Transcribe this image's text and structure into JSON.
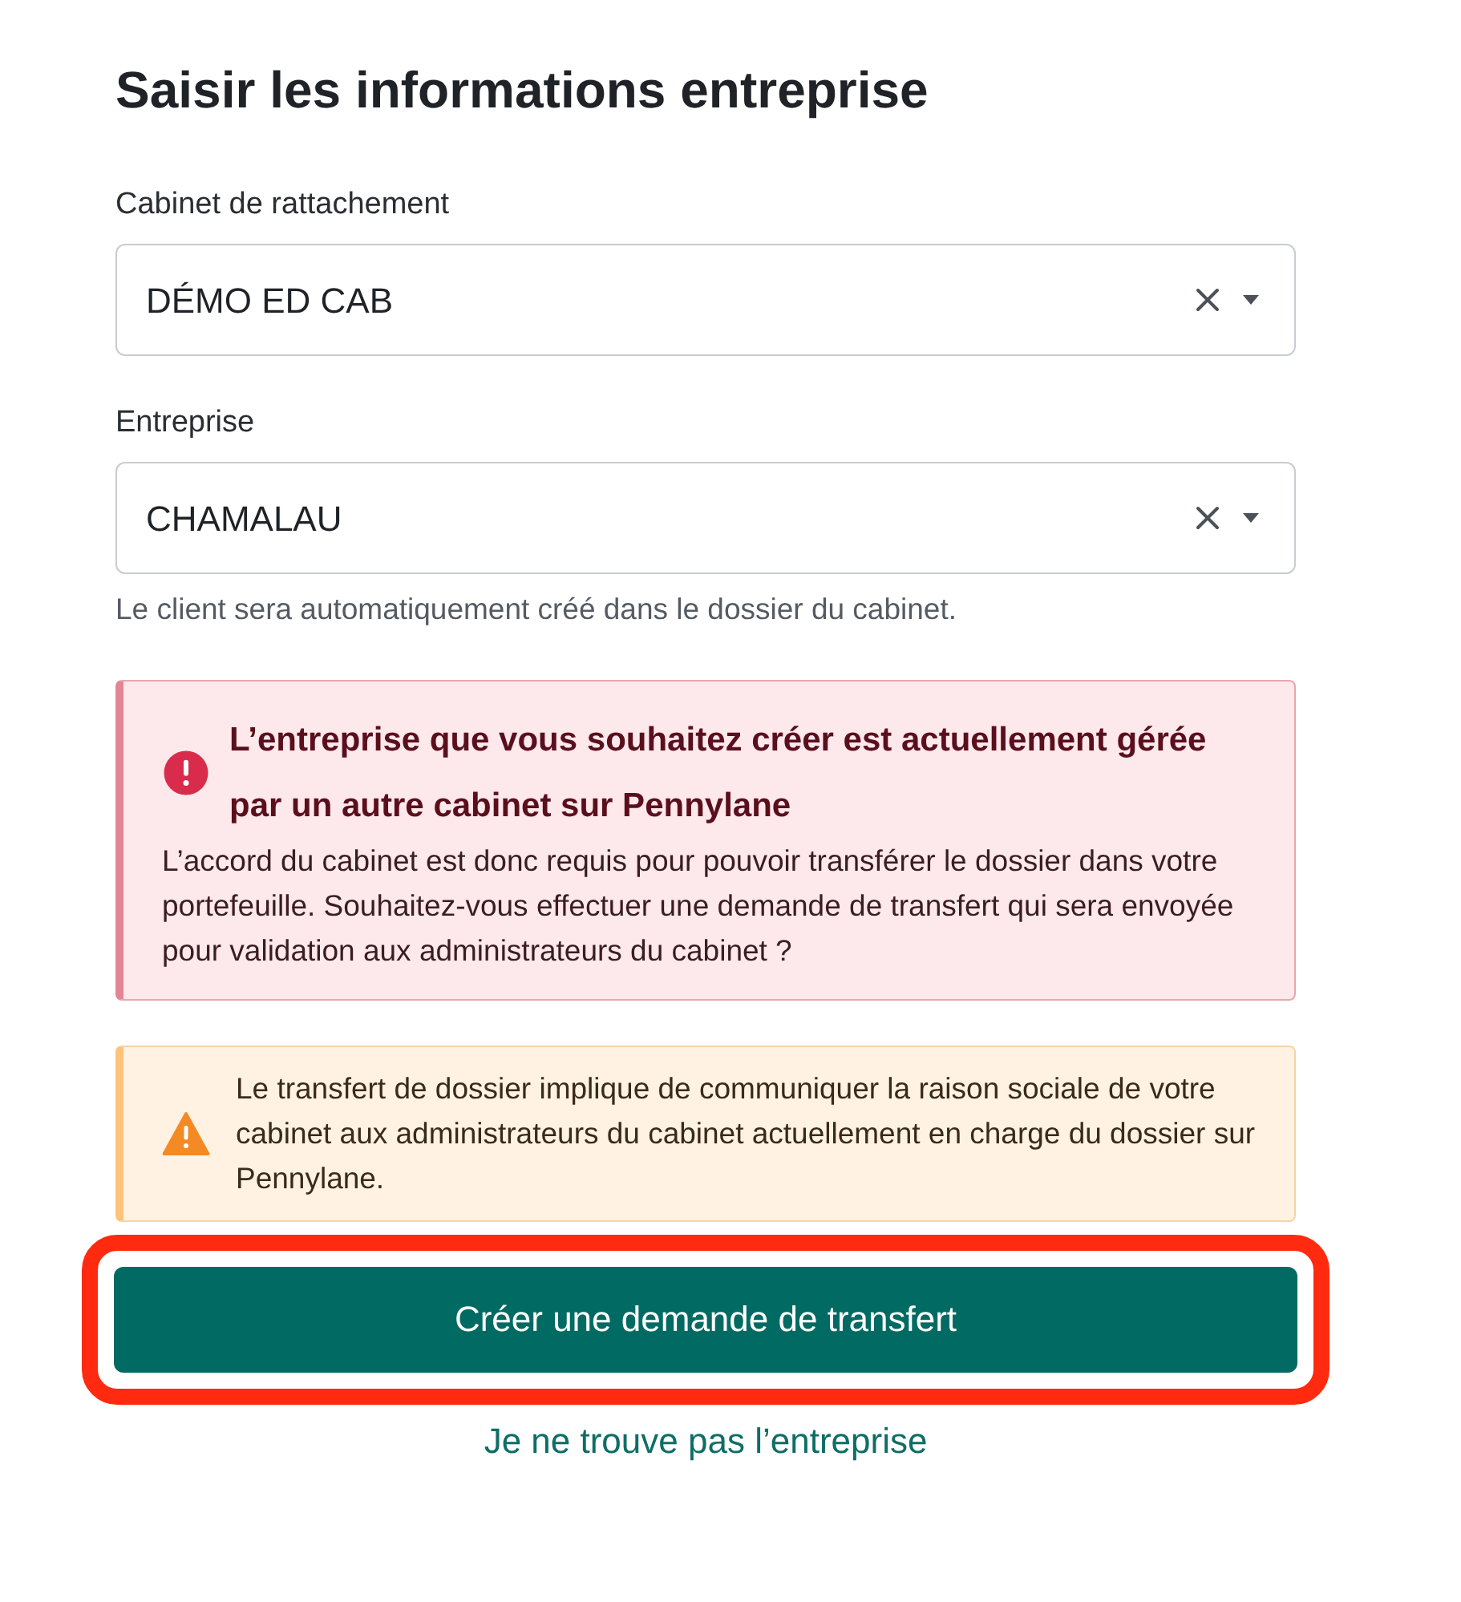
{
  "title": "Saisir les informations entreprise",
  "fields": [
    {
      "label": "Cabinet de rattachement",
      "value": "DÉMO ED CAB"
    },
    {
      "label": "Entreprise",
      "value": "CHAMALAU"
    }
  ],
  "helper_text": "Le client sera automatiquement créé dans le dossier du cabinet.",
  "alerts": [
    {
      "kind": "error",
      "title": "L’entreprise que vous souhaitez créer est actuellement gérée par un autre cabinet sur Pennylane",
      "body": "L’accord du cabinet est donc requis pour pouvoir transférer le dossier dans votre portefeuille. Souhaitez-vous effectuer une demande de transfert qui sera envoyée pour validation aux administrateurs du cabinet ?"
    },
    {
      "kind": "warning",
      "body": "Le transfert de dossier implique de communiquer la raison sociale de votre cabinet aux administrateurs du cabinet actuellement en charge du dossier sur Pennylane."
    }
  ],
  "primary_button": {
    "label": "Créer une demande de transfert",
    "highlighted": true
  },
  "link": "Je ne trouve pas l’entreprise"
}
